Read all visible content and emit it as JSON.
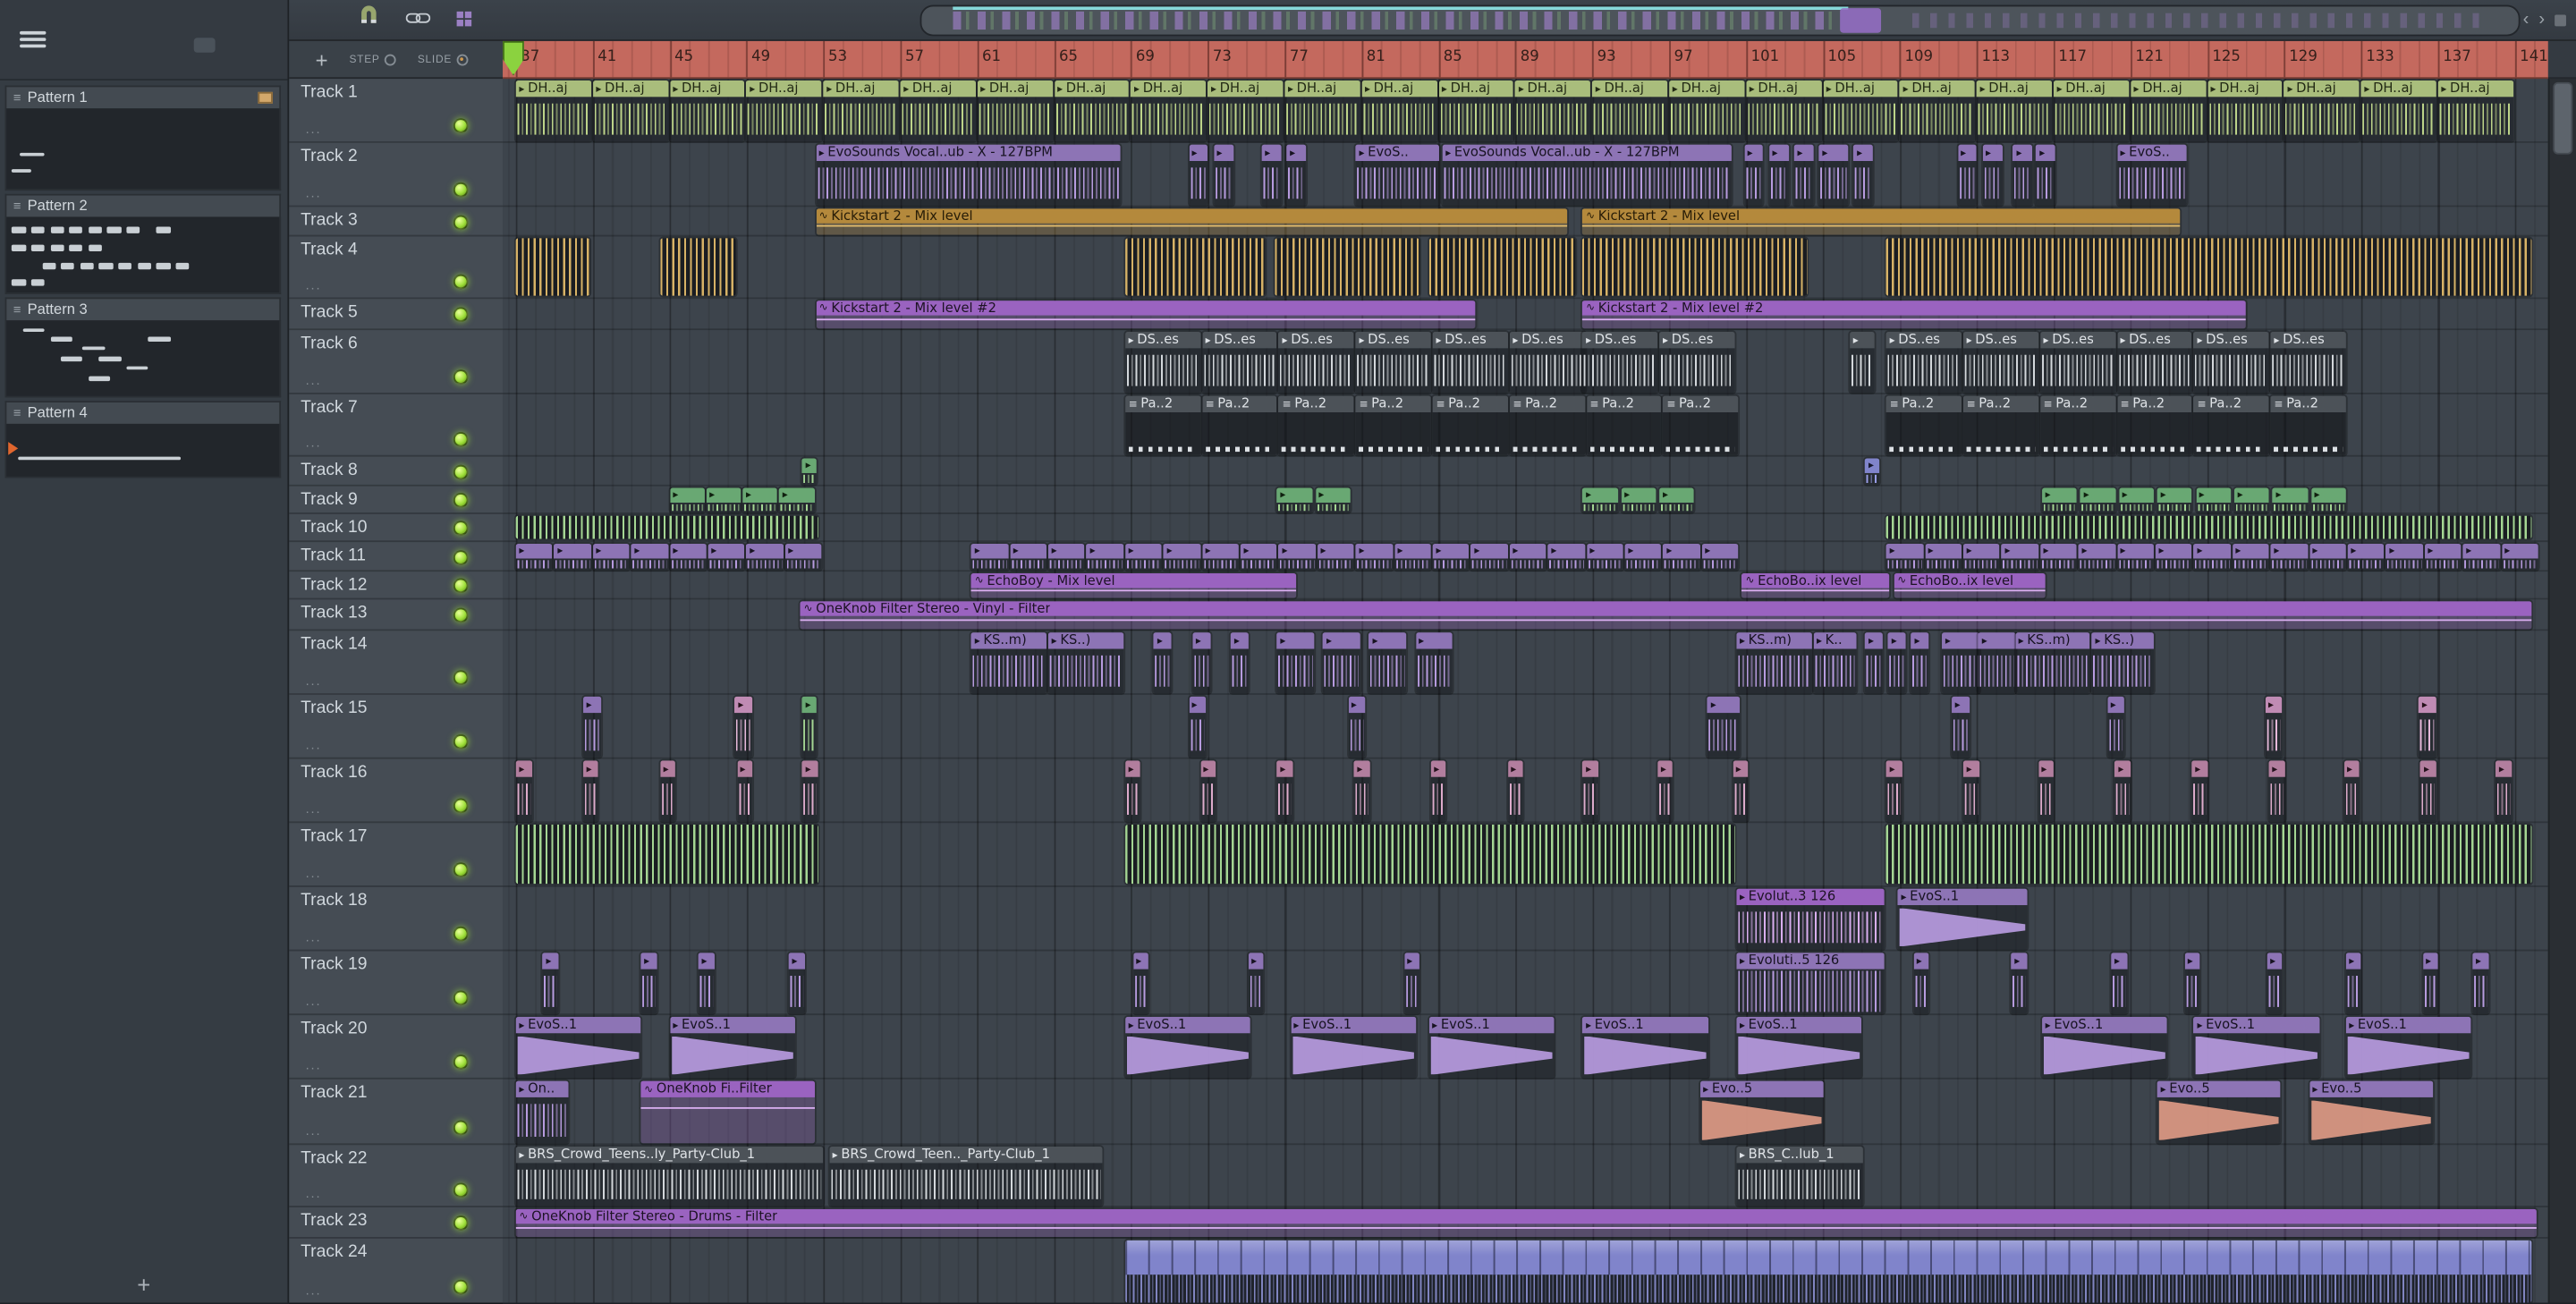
{
  "left_panel": {
    "add_label": "+",
    "patterns": [
      {
        "name": "Pattern 1",
        "badge": true,
        "thumb_h": 49,
        "marks": [
          [
            5,
            55,
            9,
            4
          ],
          [
            2,
            75,
            7,
            4
          ]
        ]
      },
      {
        "name": "Pattern 2",
        "thumb_h": 46,
        "marks": [
          [
            2,
            12,
            5,
            9
          ],
          [
            9,
            12,
            5,
            9
          ],
          [
            16,
            12,
            5,
            9
          ],
          [
            23,
            12,
            5,
            9
          ],
          [
            30,
            12,
            5,
            9
          ],
          [
            37,
            12,
            5,
            9
          ],
          [
            44,
            12,
            5,
            9
          ],
          [
            55,
            12,
            5,
            9
          ],
          [
            2,
            36,
            5,
            9
          ],
          [
            9,
            36,
            5,
            9
          ],
          [
            16,
            36,
            5,
            9
          ],
          [
            23,
            36,
            5,
            9
          ],
          [
            30,
            36,
            5,
            9
          ],
          [
            13,
            60,
            5,
            9
          ],
          [
            20,
            60,
            5,
            9
          ],
          [
            27,
            60,
            5,
            9
          ],
          [
            34,
            60,
            5,
            9
          ],
          [
            41,
            60,
            5,
            9
          ],
          [
            48,
            60,
            5,
            9
          ],
          [
            55,
            60,
            5,
            9
          ],
          [
            62,
            60,
            5,
            9
          ],
          [
            2,
            82,
            5,
            9
          ],
          [
            9,
            82,
            5,
            9
          ]
        ]
      },
      {
        "name": "Pattern 3",
        "thumb_h": 46,
        "marks": [
          [
            6,
            10,
            8,
            6
          ],
          [
            16,
            22,
            8,
            6
          ],
          [
            52,
            22,
            8,
            6
          ],
          [
            28,
            34,
            8,
            6
          ],
          [
            20,
            48,
            8,
            6
          ],
          [
            34,
            48,
            8,
            6
          ],
          [
            44,
            60,
            8,
            6
          ],
          [
            30,
            74,
            8,
            6
          ]
        ]
      },
      {
        "name": "Pattern 4",
        "thumb_h": 32,
        "play_marker": true,
        "marks": [
          [
            4,
            62,
            60,
            6
          ]
        ]
      }
    ]
  },
  "toolbar": {
    "add_track_label": "+",
    "step_label": "STEP",
    "slide_label": "SLIDE",
    "prev_label": "‹",
    "next_label": "›"
  },
  "timeline": {
    "numbers": [
      37,
      41,
      45,
      49,
      53,
      57,
      61,
      65,
      69,
      73,
      77,
      81,
      85,
      89,
      93,
      97,
      101,
      105,
      109,
      113,
      117,
      121,
      125,
      129,
      133,
      137,
      141
    ]
  },
  "icons": {
    "audio": "▸",
    "automation": "∿",
    "pattern": "≡",
    "pattern_list": "≡"
  },
  "colors": {
    "led": "#9fe03a",
    "timeline_bg": "#c4695e",
    "grid_bg": "#3d444c",
    "panel_bg": "#353c43",
    "header_bg": "#454c54",
    "clip_palette": {
      "olive": {
        "h": "#a9bd7c",
        "w": "#bdd489",
        "tx": "#232a15"
      },
      "purple": {
        "h": "#8d74b5",
        "w": "#b79bdf",
        "tx": "#171321"
      },
      "violet": {
        "h": "#9a63c0",
        "w": "#d9aef0",
        "tx": "#1d1324",
        "fill": "rgba(154,99,192,0.28)",
        "line": "#d9aef0"
      },
      "tan": {
        "h": "#b4893c",
        "w": "#d7b266",
        "tx": "#271c07",
        "fill": "rgba(180,137,60,0.30)",
        "line": "#e2bc6d"
      },
      "mauve": {
        "h": "#b27e9e",
        "w": "#ddabcb",
        "tx": "#24121c"
      },
      "green": {
        "h": "#69a873",
        "w": "#a4d693",
        "tx": "#10200f",
        "fill": "rgba(105,168,115,0.3)",
        "line": "#a4d693"
      },
      "dark": {
        "h": "#4c5258",
        "w": "#d3d7db",
        "tx": "#dfe3e7"
      },
      "blue": {
        "h": "#8084cb",
        "w": "#989de6",
        "tx": "#15172c"
      },
      "pink": {
        "h": "#c08bb4",
        "w": "#e6b9da",
        "tx": "#241119"
      },
      "salmon": {
        "h": "#8d74b5",
        "w": "#dd9a84",
        "tx": "#171321"
      }
    }
  },
  "tracks_sub": "...",
  "tracks": [
    {
      "name": "Track 1",
      "h": 39,
      "clips": [
        {
          "t": "a",
          "c": "olive",
          "b": 37,
          "w": 4,
          "l": "DH..aj",
          "r": 26
        }
      ]
    },
    {
      "name": "Track 2",
      "h": 39,
      "clips": [
        {
          "t": "a",
          "c": "purple",
          "b": 52.6,
          "w": 15.9,
          "l": "EvoSounds Vocal..ub - X - 127BPM"
        },
        {
          "t": "a",
          "c": "purple",
          "w": 1.1,
          "bs": [
            72,
            73.3,
            75.8,
            77.1
          ]
        },
        {
          "t": "a",
          "c": "purple",
          "b": 80.7,
          "w": 4.4,
          "l": "EvoS.."
        },
        {
          "t": "a",
          "c": "purple",
          "b": 85.2,
          "w": 15.1,
          "l": "EvoSounds Vocal..ub - X - 127BPM"
        },
        {
          "t": "a",
          "c": "purple",
          "w": 1.1,
          "bs": [
            100.9,
            102.2,
            103.5,
            106.6,
            112,
            113.3,
            114.9,
            116.1
          ]
        },
        {
          "t": "a",
          "c": "purple",
          "b": 104.8,
          "w": 1.6
        },
        {
          "t": "a",
          "c": "purple",
          "b": 120.3,
          "w": 3.7,
          "l": "EvoS.."
        }
      ]
    },
    {
      "name": "Track 3",
      "h": 18,
      "clips": [
        {
          "t": "au",
          "c": "tan",
          "b": 52.6,
          "w": 39.2,
          "l": "Kickstart 2 - Mix level"
        },
        {
          "t": "au",
          "c": "tan",
          "b": 92.5,
          "w": 31.2,
          "l": "Kickstart 2 - Mix level"
        }
      ]
    },
    {
      "name": "Track 4",
      "h": 38,
      "clips": [
        {
          "t": "st",
          "c": "tan",
          "b": 37,
          "w": 3.9
        },
        {
          "t": "st",
          "c": "tan",
          "b": 44.5,
          "w": 4
        },
        {
          "t": "st",
          "c": "tan",
          "b": 68.7,
          "w": 7.4
        },
        {
          "t": "st",
          "c": "tan",
          "b": 76.5,
          "w": 7.6
        },
        {
          "t": "st",
          "c": "tan",
          "b": 84.5,
          "w": 7.7
        },
        {
          "t": "st",
          "c": "tan",
          "b": 92.5,
          "w": 11.8
        },
        {
          "t": "st",
          "c": "tan",
          "b": 108.3,
          "w": 33.7
        }
      ]
    },
    {
      "name": "Track 5",
      "h": 19,
      "clips": [
        {
          "t": "au",
          "c": "violet",
          "b": 52.6,
          "w": 34.4,
          "l": "Kickstart 2 - Mix level #2"
        },
        {
          "t": "au",
          "c": "violet",
          "b": 92.5,
          "w": 34.6,
          "l": "Kickstart 2 - Mix level #2"
        }
      ]
    },
    {
      "name": "Track 6",
      "h": 39,
      "clips": [
        {
          "t": "a",
          "c": "dark",
          "b": 68.7,
          "w": 4,
          "l": "DS..es",
          "r": 6
        },
        {
          "t": "a",
          "c": "dark",
          "b": 92.5,
          "w": 4,
          "l": "DS..es",
          "r": 2
        },
        {
          "t": "a",
          "c": "dark",
          "b": 106.4,
          "w": 1.4
        },
        {
          "t": "a",
          "c": "dark",
          "b": 108.3,
          "w": 4,
          "l": "DS..es",
          "r": 6
        }
      ]
    },
    {
      "name": "Track 7",
      "h": 38,
      "clips": [
        {
          "t": "pt",
          "c": "dark",
          "b": 68.7,
          "w": 4,
          "l": "Pa..2",
          "r": 8
        },
        {
          "t": "pt",
          "c": "dark",
          "b": 108.3,
          "w": 4,
          "l": "Pa..2",
          "r": 6
        }
      ]
    },
    {
      "name": "Track 8",
      "h": 18,
      "clips": [
        {
          "t": "a",
          "c": "green",
          "b": 51.9,
          "w": 0.8
        },
        {
          "t": "a",
          "c": "blue",
          "b": 107.2,
          "w": 0.8
        }
      ]
    },
    {
      "name": "Track 9",
      "h": 17,
      "clips": [
        {
          "t": "a",
          "c": "green",
          "b": 45,
          "w": 1.9,
          "r": 4
        },
        {
          "t": "a",
          "c": "green",
          "w": 1.9,
          "bs": [
            76.6,
            78.6,
            92.5,
            94.5,
            96.5,
            116.4,
            118.4,
            120.4,
            122.4,
            124.4,
            126.4,
            128.4,
            130.4
          ]
        }
      ]
    },
    {
      "name": "Track 10",
      "h": 17,
      "clips": [
        {
          "t": "st",
          "c": "green",
          "b": 37,
          "w": 15.8
        },
        {
          "t": "st",
          "c": "green",
          "b": 108.3,
          "w": 33.7
        }
      ]
    },
    {
      "name": "Track 11",
      "h": 18,
      "clips": [
        {
          "t": "a",
          "c": "purple",
          "b": 37,
          "w": 2,
          "r": 8
        },
        {
          "t": "a",
          "c": "purple",
          "b": 60.7,
          "w": 2,
          "r": 20
        },
        {
          "t": "a",
          "c": "purple",
          "b": 108.3,
          "w": 2,
          "r": 17
        }
      ]
    },
    {
      "name": "Track 12",
      "h": 17,
      "clips": [
        {
          "t": "au",
          "c": "violet",
          "b": 60.7,
          "w": 17,
          "l": "EchoBoy - Mix level"
        },
        {
          "t": "au",
          "c": "violet",
          "b": 100.8,
          "w": 7.7,
          "l": "EchoBo..ix level"
        },
        {
          "t": "au",
          "c": "violet",
          "b": 108.7,
          "w": 8,
          "l": "EchoBo..ix level"
        }
      ]
    },
    {
      "name": "Track 13",
      "h": 19,
      "clips": [
        {
          "t": "au",
          "c": "violet",
          "b": 51.8,
          "w": 90.2,
          "l": "OneKnob Filter Stereo - Vinyl - Filter"
        }
      ]
    },
    {
      "name": "Track 14",
      "h": 39,
      "clips": [
        {
          "t": "a",
          "c": "purple",
          "b": 60.7,
          "w": 4,
          "l": "KS..m)"
        },
        {
          "t": "a",
          "c": "purple",
          "b": 64.7,
          "w": 4,
          "l": "KS..)"
        },
        {
          "t": "a",
          "c": "purple",
          "w": 1,
          "bs": [
            70.2,
            72.2,
            74.2,
            107.2,
            108.4,
            109.6
          ]
        },
        {
          "t": "a",
          "c": "purple",
          "w": 2,
          "bs": [
            76.6,
            79,
            81.4,
            83.8,
            111.2,
            113.1
          ]
        },
        {
          "t": "a",
          "c": "purple",
          "b": 100.5,
          "w": 4,
          "l": "KS..m)"
        },
        {
          "t": "a",
          "c": "purple",
          "b": 104.5,
          "w": 2.3,
          "l": "K.."
        },
        {
          "t": "a",
          "c": "purple",
          "b": 115,
          "w": 4,
          "l": "KS..m)"
        },
        {
          "t": "a",
          "c": "purple",
          "b": 119,
          "w": 3.3,
          "l": "KS..)"
        }
      ]
    },
    {
      "name": "Track 15",
      "h": 39,
      "clips": [
        {
          "t": "a",
          "c": "purple",
          "w": 1,
          "bs": [
            40.5,
            72,
            80.3,
            111.7,
            119.8
          ]
        },
        {
          "t": "a",
          "c": "pink",
          "w": 1,
          "bs": [
            48.4,
            128,
            136
          ]
        },
        {
          "t": "a",
          "c": "green",
          "b": 51.9,
          "w": 0.8
        },
        {
          "t": "a",
          "c": "purple",
          "b": 99,
          "w": 1.8
        }
      ]
    },
    {
      "name": "Track 16",
      "h": 39,
      "clips": [
        {
          "t": "a",
          "c": "mauve",
          "w": 0.9,
          "bs": [
            37,
            40.5,
            44.5,
            48.5,
            51.9,
            68.7,
            72.6,
            76.6,
            80.6,
            84.6,
            88.6,
            92.5,
            96.4,
            100.3,
            108.3,
            112.3,
            116.2,
            120.2,
            124.2,
            128.2,
            132.1,
            136.1,
            140
          ]
        }
      ]
    },
    {
      "name": "Track 17",
      "h": 39,
      "clips": [
        {
          "t": "st",
          "c": "green",
          "b": 37,
          "w": 15.8
        },
        {
          "t": "st",
          "c": "green",
          "b": 68.7,
          "w": 31.8
        },
        {
          "t": "st",
          "c": "green",
          "b": 108.3,
          "w": 33.7
        }
      ]
    },
    {
      "name": "Track 18",
      "h": 39,
      "clips": [
        {
          "t": "a",
          "c": "violet",
          "b": 100.5,
          "w": 7.8,
          "l": "Evolut..3 126"
        },
        {
          "t": "tri",
          "c": "purple",
          "b": 108.9,
          "w": 6.8,
          "l": "EvoS..1"
        }
      ]
    },
    {
      "name": "Track 19",
      "h": 39,
      "clips": [
        {
          "t": "a",
          "c": "purple",
          "w": 0.9,
          "bs": [
            38.4,
            43.5,
            46.5,
            51.2,
            69.1,
            75.1,
            83.2,
            109.7,
            114.8,
            120,
            123.8,
            128.1,
            132.2,
            136.2,
            138.8
          ]
        },
        {
          "t": "a",
          "c": "purple",
          "b": 100.5,
          "w": 7.8,
          "l": "Evoluti..5 126",
          "dense": true
        }
      ]
    },
    {
      "name": "Track 20",
      "h": 39,
      "clips": [
        {
          "t": "tri",
          "c": "purple",
          "w": 6.6,
          "l": "EvoS..1",
          "bs": [
            37,
            45,
            68.7,
            77.3,
            84.5,
            92.5,
            100.5,
            116.4,
            124.3,
            132.2
          ]
        }
      ]
    },
    {
      "name": "Track 21",
      "h": 40,
      "clips": [
        {
          "t": "a",
          "c": "purple",
          "b": 37,
          "w": 2.8,
          "l": "On.."
        },
        {
          "t": "au",
          "c": "violet",
          "b": 43.5,
          "w": 9.1,
          "l": "OneKnob Fi..Filter"
        },
        {
          "t": "tri",
          "c": "purple",
          "wc": "salmon",
          "w": 6.5,
          "l": "Evo..5",
          "bs": [
            98.6,
            122.4,
            130.3
          ]
        }
      ]
    },
    {
      "name": "Track 22",
      "h": 38,
      "clips": [
        {
          "t": "a",
          "c": "dark",
          "b": 37,
          "w": 16.1,
          "l": "BRS_Crowd_Teens..ly_Party-Club_1"
        },
        {
          "t": "a",
          "c": "dark",
          "b": 53.3,
          "w": 14.3,
          "l": "BRS_Crowd_Teen.._Party-Club_1"
        },
        {
          "t": "a",
          "c": "dark",
          "b": 100.5,
          "w": 6.7,
          "l": "BRS_C..lub_1"
        }
      ]
    },
    {
      "name": "Track 23",
      "h": 19,
      "clips": [
        {
          "t": "au",
          "c": "violet",
          "b": 37,
          "w": 105.2,
          "l": "OneKnob Filter Stereo - Drums - Filter"
        }
      ]
    },
    {
      "name": "Track 24",
      "h": 40,
      "clips": [
        {
          "t": "seg",
          "c": "blue",
          "b": 68.7,
          "w": 73.3
        }
      ]
    }
  ]
}
